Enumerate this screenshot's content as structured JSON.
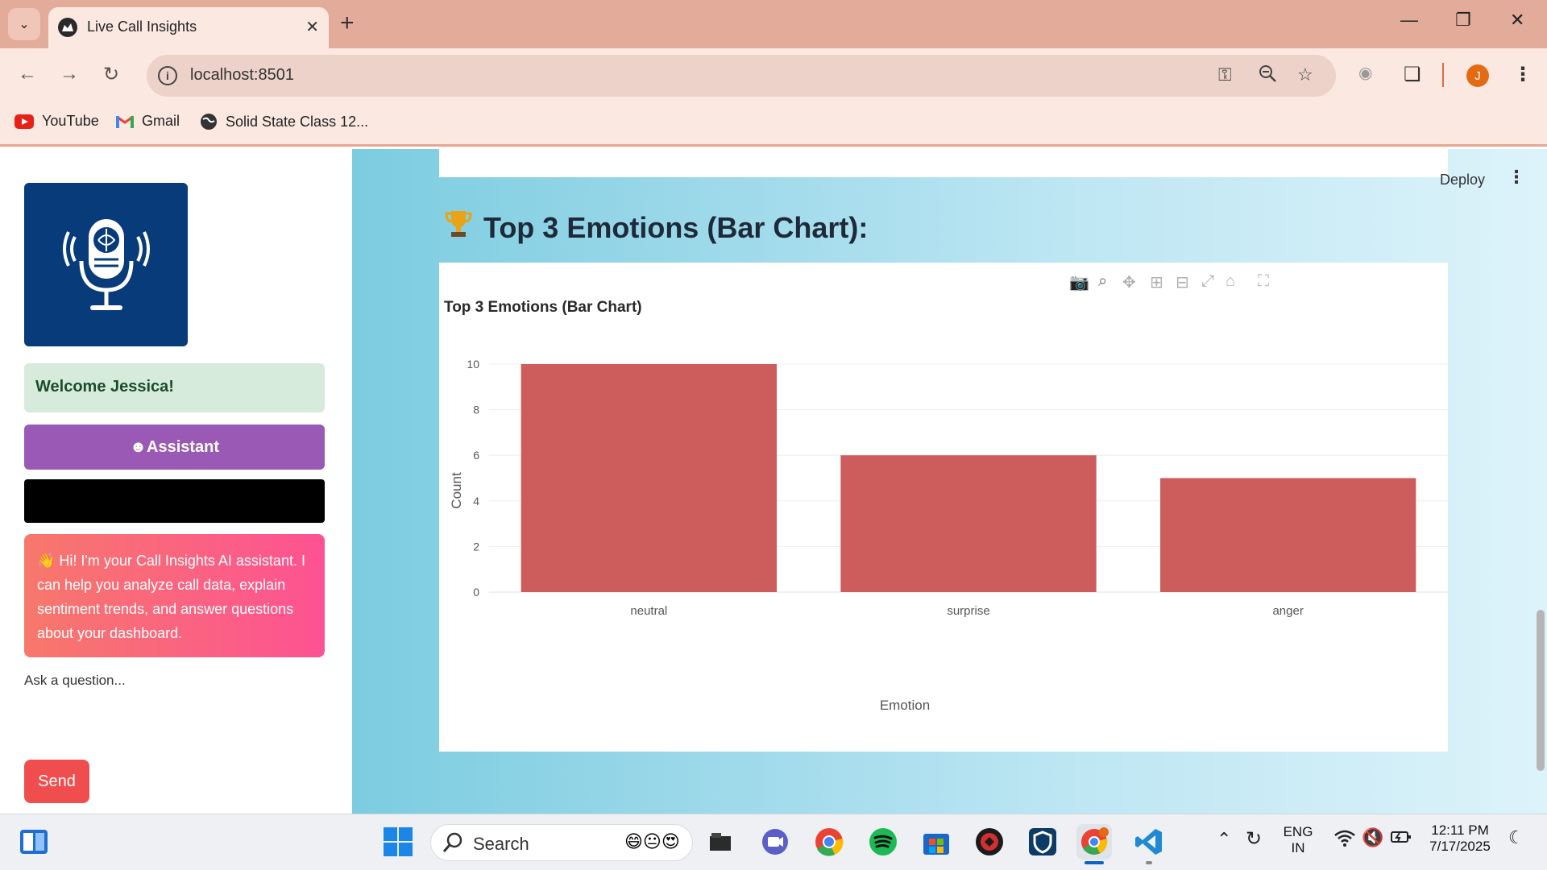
{
  "browser": {
    "tab_title": "Live Call Insights",
    "url": "localhost:8501",
    "profile_initial": "J",
    "bookmarks": [
      {
        "label": "YouTube",
        "icon": "youtube-icon"
      },
      {
        "label": "Gmail",
        "icon": "gmail-icon"
      },
      {
        "label": "Solid State Class 12...",
        "icon": "globe-icon"
      }
    ]
  },
  "sidebar": {
    "logo_icon": "microphone-brain-icon",
    "welcome": "Welcome Jessica!",
    "assistant_label": "☻Assistant",
    "assistant_message": "👋 Hi! I'm your Call Insights AI assistant. I can help you analyze call data, explain sentiment trends, and answer questions about your dashboard.",
    "ask_label": "Ask a question...",
    "send_label": "Send"
  },
  "main": {
    "deploy_label": "Deploy",
    "section_title": "Top 3 Emotions (Bar Chart):",
    "section_icon": "trophy-icon"
  },
  "chart_data": {
    "type": "bar",
    "title": "Top 3 Emotions (Bar Chart)",
    "categories": [
      "neutral",
      "surprise",
      "anger"
    ],
    "values": [
      10,
      6,
      5
    ],
    "xlabel": "Emotion",
    "ylabel": "Count",
    "ylim": [
      0,
      10
    ],
    "yticks": [
      0,
      2,
      4,
      6,
      8,
      10
    ],
    "bar_color": "#cd5c5c",
    "grid": true
  },
  "taskbar": {
    "search_placeholder": "Search",
    "lang_line1": "ENG",
    "lang_line2": "IN",
    "time": "12:11 PM",
    "date": "7/17/2025"
  },
  "colors": {
    "tab_strip": "#e3ab9a",
    "assistant": "#9b59b6",
    "send": "#f04e4e",
    "welcome_bg": "#d6ebdb"
  }
}
